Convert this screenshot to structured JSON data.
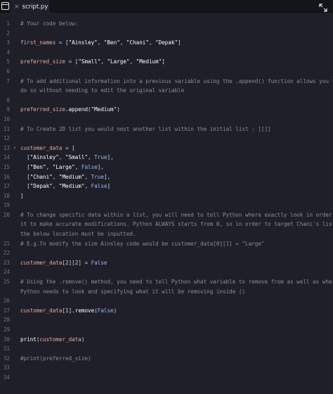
{
  "tab": {
    "label": "script.py",
    "close_glyph": "×"
  },
  "lines": [
    {
      "n": "1",
      "segs": [
        {
          "t": "# Your code below:",
          "c": "cm"
        }
      ]
    },
    {
      "n": "2",
      "segs": []
    },
    {
      "n": "3",
      "segs": [
        {
          "t": "first_names",
          "c": "var"
        },
        {
          "t": " = [",
          "c": ""
        },
        {
          "t": "\"Ainsley\"",
          "c": "str"
        },
        {
          "t": ", ",
          "c": ""
        },
        {
          "t": "\"Ben\"",
          "c": "str"
        },
        {
          "t": ", ",
          "c": ""
        },
        {
          "t": "\"Chani\"",
          "c": "str"
        },
        {
          "t": ", ",
          "c": ""
        },
        {
          "t": "\"Depak\"",
          "c": "str"
        },
        {
          "t": "]",
          "c": ""
        }
      ]
    },
    {
      "n": "4",
      "segs": []
    },
    {
      "n": "5",
      "segs": [
        {
          "t": "preferred_size",
          "c": "var"
        },
        {
          "t": " = [",
          "c": ""
        },
        {
          "t": "\"Small\"",
          "c": "str"
        },
        {
          "t": ", ",
          "c": ""
        },
        {
          "t": "\"Large\"",
          "c": "str"
        },
        {
          "t": ", ",
          "c": ""
        },
        {
          "t": "\"Medium\"",
          "c": "str"
        },
        {
          "t": "]",
          "c": ""
        }
      ]
    },
    {
      "n": "6",
      "segs": []
    },
    {
      "n": "7",
      "segs": [
        {
          "t": "# To add additional information into a previous variable using the .append() function allows you to",
          "c": "cm"
        }
      ]
    },
    {
      "n": "",
      "segs": [
        {
          "t": "do so without needing to edit the original variable",
          "c": "cm"
        }
      ]
    },
    {
      "n": "8",
      "segs": []
    },
    {
      "n": "9",
      "segs": [
        {
          "t": "preferred_size",
          "c": "var"
        },
        {
          "t": ".append",
          "c": "fn"
        },
        {
          "t": "(",
          "c": ""
        },
        {
          "t": "\"Medium\"",
          "c": "str"
        },
        {
          "t": ")",
          "c": ""
        }
      ]
    },
    {
      "n": "10",
      "segs": []
    },
    {
      "n": "11",
      "segs": [
        {
          "t": "# To Create 2D list you would nest another list within the initial list : [[]]",
          "c": "cm"
        }
      ]
    },
    {
      "n": "12",
      "segs": []
    },
    {
      "n": "13",
      "fold": "▾",
      "segs": [
        {
          "t": "customer_data",
          "c": "var"
        },
        {
          "t": " = [",
          "c": ""
        }
      ]
    },
    {
      "n": "14",
      "segs": [
        {
          "t": "  [",
          "c": ""
        },
        {
          "t": "\"Ainsley\"",
          "c": "str"
        },
        {
          "t": ", ",
          "c": ""
        },
        {
          "t": "\"Small\"",
          "c": "str"
        },
        {
          "t": ", ",
          "c": ""
        },
        {
          "t": "True",
          "c": "bool"
        },
        {
          "t": "],",
          "c": ""
        }
      ]
    },
    {
      "n": "15",
      "segs": [
        {
          "t": "  [",
          "c": ""
        },
        {
          "t": "\"Ben\"",
          "c": "str"
        },
        {
          "t": ", ",
          "c": ""
        },
        {
          "t": "\"Large\"",
          "c": "str"
        },
        {
          "t": ", ",
          "c": ""
        },
        {
          "t": "False",
          "c": "bool"
        },
        {
          "t": "],",
          "c": ""
        }
      ]
    },
    {
      "n": "16",
      "segs": [
        {
          "t": "  [",
          "c": ""
        },
        {
          "t": "\"Chani\"",
          "c": "str"
        },
        {
          "t": ", ",
          "c": ""
        },
        {
          "t": "\"Medium\"",
          "c": "str"
        },
        {
          "t": ", ",
          "c": ""
        },
        {
          "t": "True",
          "c": "bool"
        },
        {
          "t": "],",
          "c": ""
        }
      ]
    },
    {
      "n": "17",
      "segs": [
        {
          "t": "  [",
          "c": ""
        },
        {
          "t": "\"Depak\"",
          "c": "str"
        },
        {
          "t": ", ",
          "c": ""
        },
        {
          "t": "\"Medium\"",
          "c": "str"
        },
        {
          "t": ", ",
          "c": ""
        },
        {
          "t": "False",
          "c": "bool"
        },
        {
          "t": "]",
          "c": ""
        }
      ]
    },
    {
      "n": "18",
      "segs": [
        {
          "t": "]",
          "c": ""
        }
      ]
    },
    {
      "n": "19",
      "segs": []
    },
    {
      "n": "20",
      "segs": [
        {
          "t": "# To change specific data within a list, you will need to tell Python where exactly look in order for",
          "c": "cm"
        }
      ]
    },
    {
      "n": "",
      "segs": [
        {
          "t": "it to make accurate modifications. Python ALWAYS starts from 0, so in order to target Chani's list",
          "c": "cm"
        }
      ]
    },
    {
      "n": "",
      "segs": [
        {
          "t": "the below location must be inputted.",
          "c": "cm"
        }
      ]
    },
    {
      "n": "21",
      "segs": [
        {
          "t": "# E.g.To modify the size Ainsley code would be customer_data[0][1] = \"Large\"",
          "c": "cm"
        }
      ]
    },
    {
      "n": "22",
      "segs": []
    },
    {
      "n": "23",
      "segs": [
        {
          "t": "customer_data",
          "c": "var"
        },
        {
          "t": "[",
          "c": ""
        },
        {
          "t": "2",
          "c": "num"
        },
        {
          "t": "][",
          "c": ""
        },
        {
          "t": "2",
          "c": "num"
        },
        {
          "t": "] = ",
          "c": ""
        },
        {
          "t": "False",
          "c": "bool"
        }
      ]
    },
    {
      "n": "24",
      "segs": []
    },
    {
      "n": "25",
      "segs": [
        {
          "t": "# Using the .remove() method, you need to tell Python what variable to remove from as well as where",
          "c": "cm"
        }
      ]
    },
    {
      "n": "",
      "segs": [
        {
          "t": "Python needs to look and specifying what it will be removing inside ()",
          "c": "cm"
        }
      ]
    },
    {
      "n": "26",
      "segs": []
    },
    {
      "n": "27",
      "segs": [
        {
          "t": "customer_data",
          "c": "var"
        },
        {
          "t": "[",
          "c": ""
        },
        {
          "t": "1",
          "c": "num"
        },
        {
          "t": "]",
          "c": ""
        },
        {
          "t": ".remove",
          "c": "fn"
        },
        {
          "t": "(",
          "c": ""
        },
        {
          "t": "False",
          "c": "bool"
        },
        {
          "t": ")",
          "c": ""
        }
      ]
    },
    {
      "n": "28",
      "segs": []
    },
    {
      "n": "29",
      "segs": []
    },
    {
      "n": "30",
      "segs": [
        {
          "t": "print",
          "c": "fn"
        },
        {
          "t": "(",
          "c": ""
        },
        {
          "t": "customer_data",
          "c": "var"
        },
        {
          "t": ")",
          "c": ""
        }
      ]
    },
    {
      "n": "31",
      "segs": []
    },
    {
      "n": "32",
      "segs": [
        {
          "t": "#print(preferred_size)",
          "c": "cm"
        }
      ]
    },
    {
      "n": "33",
      "segs": []
    },
    {
      "n": "34",
      "segs": []
    }
  ]
}
